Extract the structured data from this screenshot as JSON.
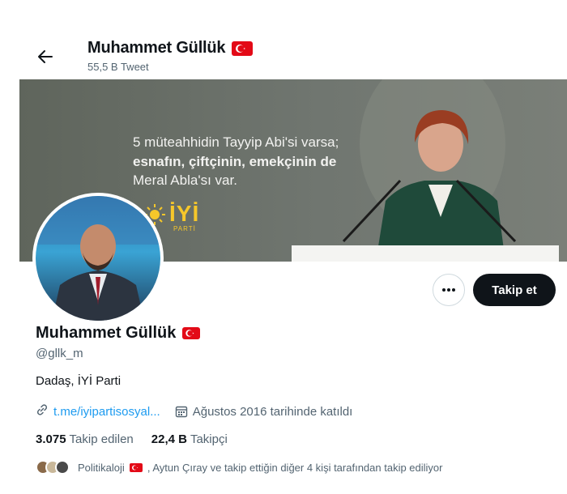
{
  "header": {
    "name": "Muhammet Güllük",
    "tweet_count": "55,5 B Tweet"
  },
  "banner": {
    "line1": "5 müteahhidin Tayyip Abi'si varsa;",
    "line2": "esnafın, çiftçinin, emekçinin de",
    "line3": "Meral Abla'sı var.",
    "logo": "İYİ",
    "logo_sub": "PARTİ"
  },
  "actions": {
    "more_label": "···",
    "follow_label": "Takip et"
  },
  "profile": {
    "name": "Muhammet Güllük",
    "handle": "@gllk_m",
    "bio": "Dadaş, İYİ Parti",
    "link": "t.me/iyipartisosyal...",
    "joined": "Ağustos 2016 tarihinde katıldı",
    "following_count": "3.075",
    "following_label": "Takip edilen",
    "followers_count": "22,4 B",
    "followers_label": "Takipçi",
    "known_followers_prefix": "Politikaloji",
    "known_followers_suffix": ", Aytun Çıray ve takip ettiğin diğer 4 kişi tarafından takip ediliyor"
  },
  "colors": {
    "accent": "#1d9bf0",
    "flag_red": "#e30a17",
    "button_dark": "#0f1419",
    "secondary_text": "#536471"
  },
  "icons": [
    "back-arrow-icon",
    "turkish-flag-icon",
    "more-icon",
    "link-icon",
    "calendar-icon",
    "sun-icon"
  ]
}
